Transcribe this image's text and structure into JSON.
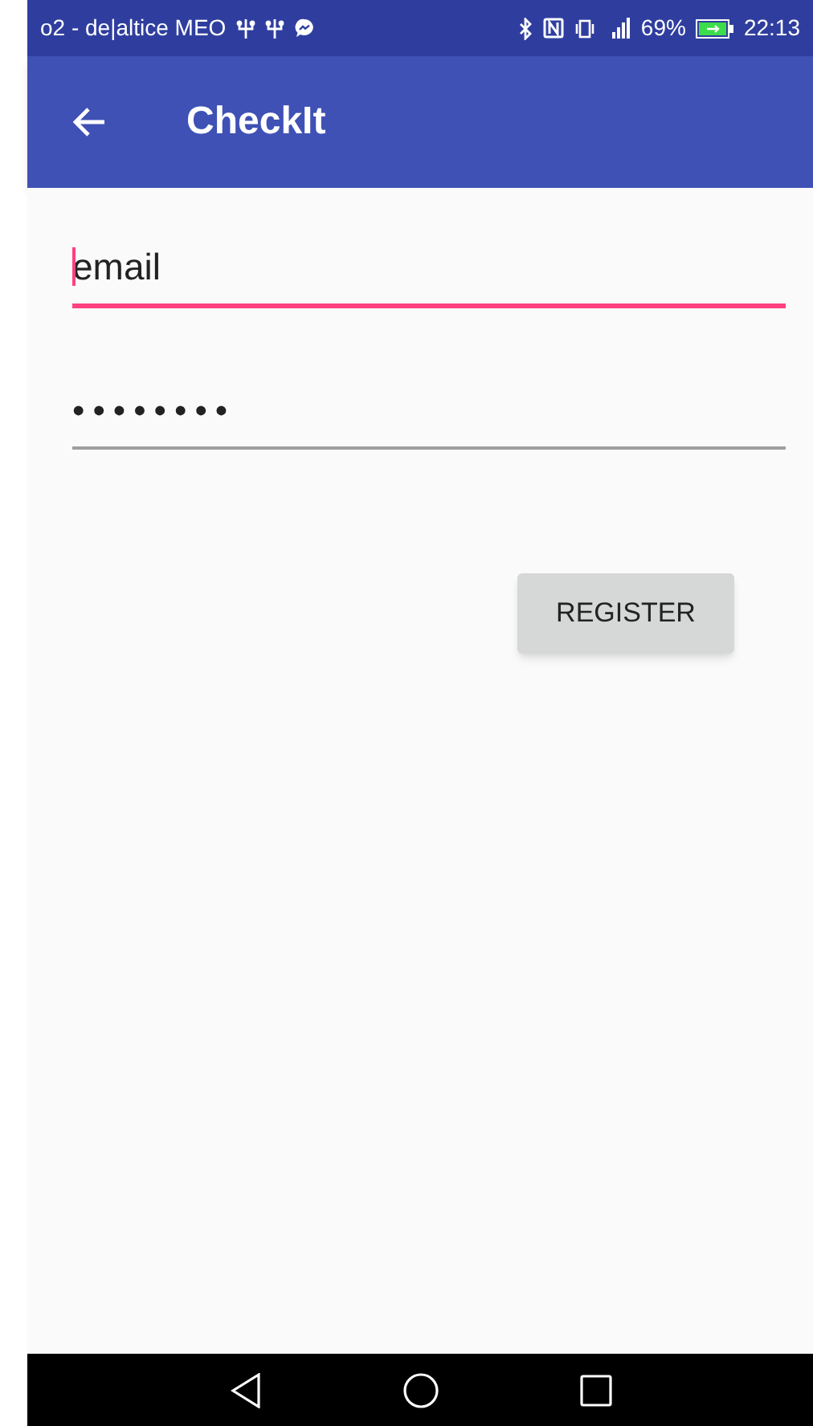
{
  "status_bar": {
    "carrier": "o2 - de|altice MEO",
    "battery": "69%",
    "time": "22:13"
  },
  "app_bar": {
    "title": "CheckIt"
  },
  "fields": [
    {
      "kind": "email",
      "value": "email",
      "focused": true
    },
    {
      "kind": "password",
      "value": "••••••••",
      "focused": false
    }
  ],
  "button": {
    "label": "REGISTER"
  }
}
